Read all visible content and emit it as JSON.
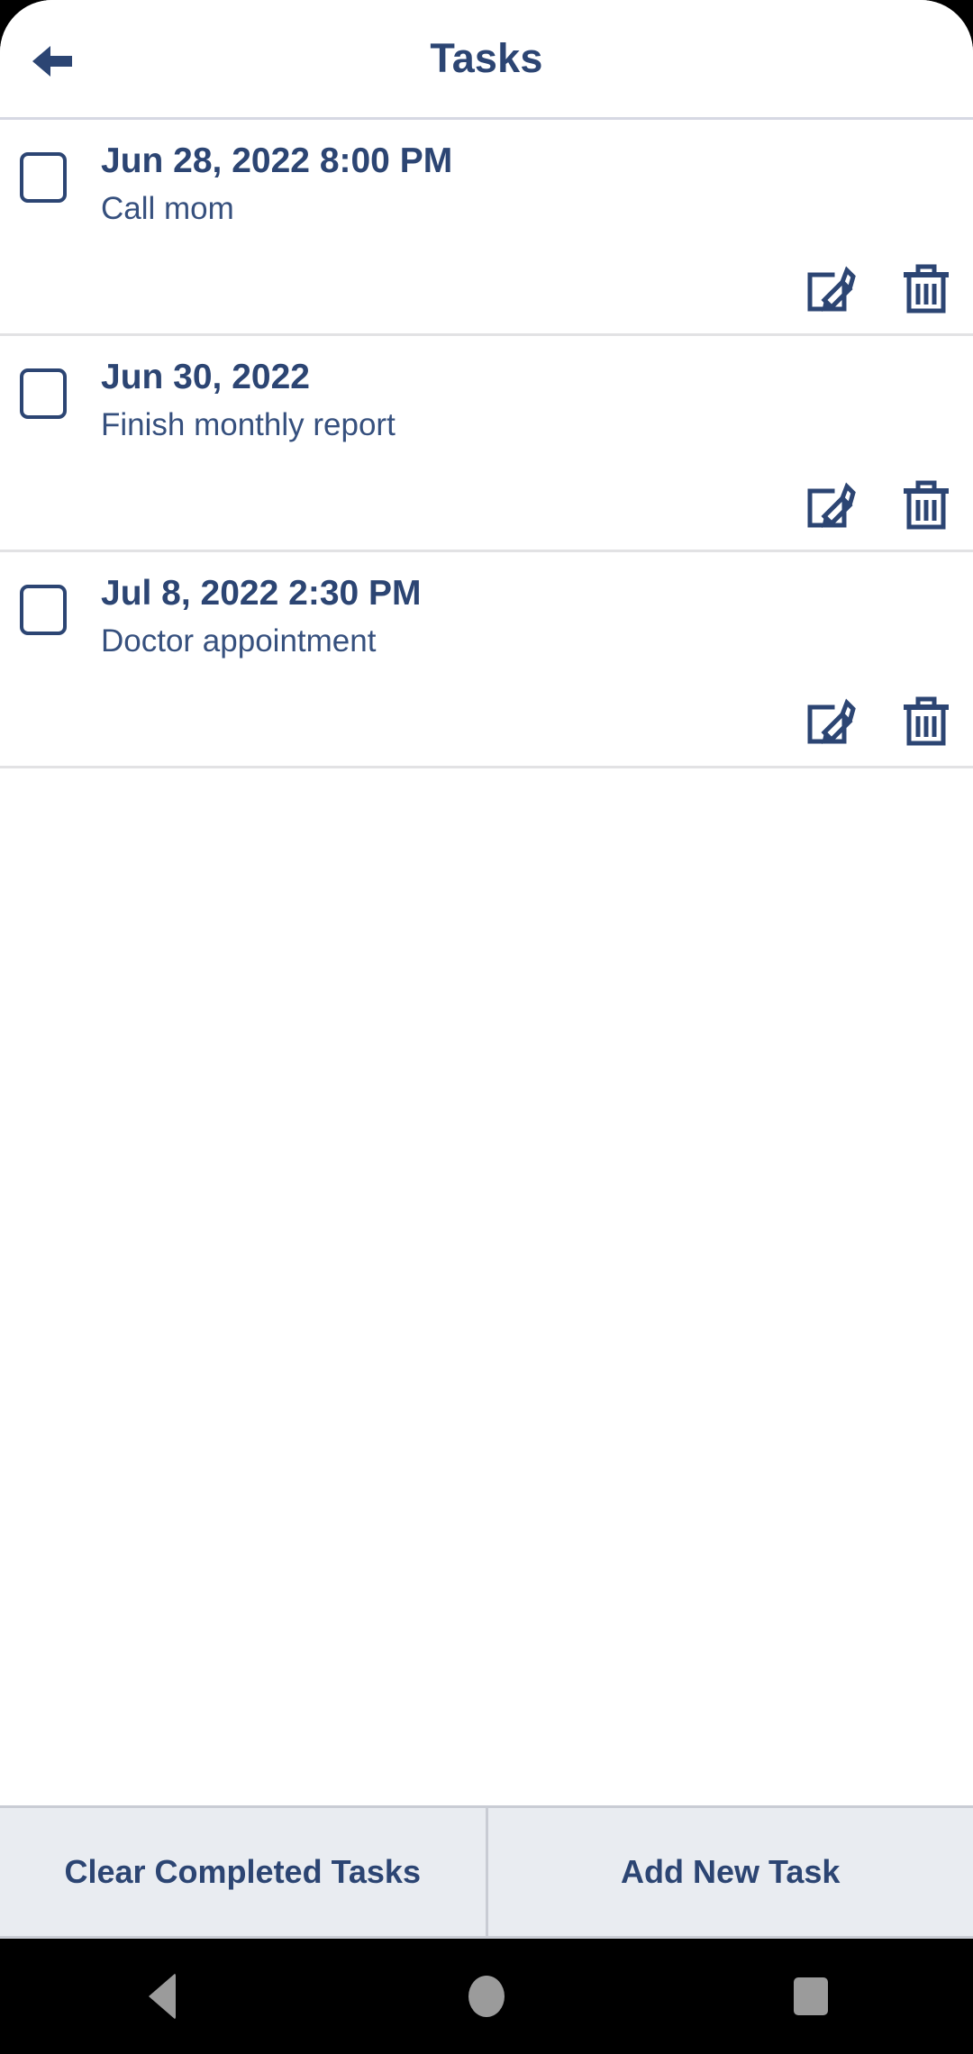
{
  "app_bar": {
    "title": "Tasks",
    "back_icon": "arrow-left-icon"
  },
  "tasks": [
    {
      "date": "Jun 28, 2022 8:00 PM",
      "title": "Call mom",
      "checked": false,
      "edit_icon": "edit-pencil-icon",
      "delete_icon": "trash-icon"
    },
    {
      "date": "Jun 30, 2022",
      "title": "Finish monthly report",
      "checked": false,
      "edit_icon": "edit-pencil-icon",
      "delete_icon": "trash-icon"
    },
    {
      "date": "Jul 8, 2022 2:30 PM",
      "title": "Doctor appointment",
      "checked": false,
      "edit_icon": "edit-pencil-icon",
      "delete_icon": "trash-icon"
    }
  ],
  "bottom_bar": {
    "clear_label": "Clear Completed Tasks",
    "add_label": "Add New Task"
  },
  "nav_bar": {
    "back_icon": "nav-back-triangle-icon",
    "home_icon": "nav-home-circle-icon",
    "recents_icon": "nav-recents-square-icon"
  },
  "colors": {
    "accent": "#2c4573",
    "text_secondary": "#36507e",
    "row_divider": "#e2e2e4",
    "appbar_divider": "#d6d8e3",
    "bottom_bar_bg": "#e9ecf1",
    "bottom_bar_border": "#c9ccd4",
    "nav_bar_bg": "#000000",
    "nav_icon": "#9b9b9b",
    "surface": "#ffffff"
  }
}
